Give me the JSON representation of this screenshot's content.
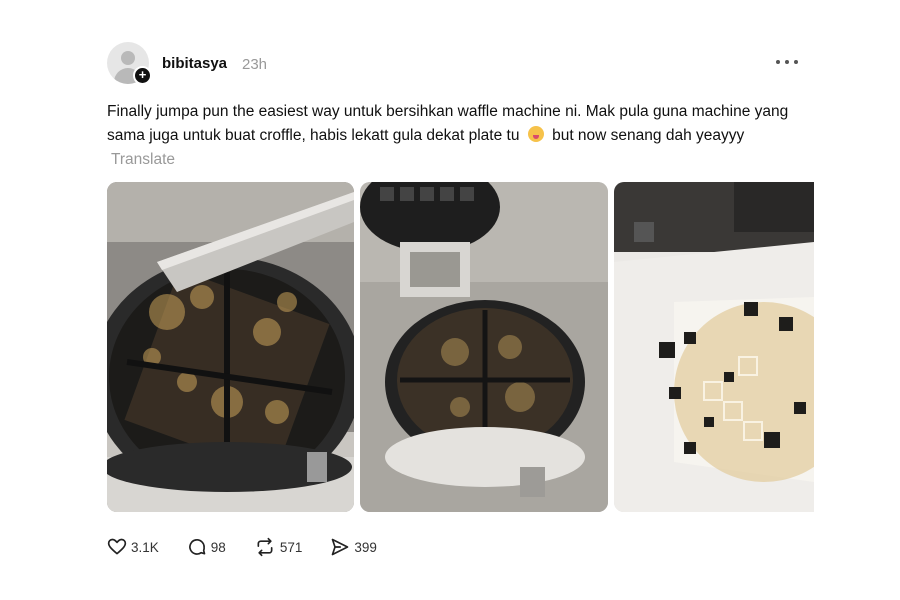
{
  "post": {
    "username": "bibitasya",
    "time": "23h",
    "text_before_emoji": "Finally jumpa pun the easiest way untuk bersihkan waffle machine ni. Mak pula guna machine yang sama juga untuk buat croffle, habis lekatt gula dekat plate tu",
    "text_after_emoji": "but now senang dah yeayyy",
    "translate_label": "Translate",
    "media": [
      {
        "description": "waffle maker plate with tongs scraping caramelized sugar"
      },
      {
        "description": "open waffle maker with dirty lower plate"
      },
      {
        "description": "peeled caramelized sugar waffle on paper towel"
      }
    ]
  },
  "actions": {
    "likes": "3.1K",
    "replies": "98",
    "reposts": "571",
    "shares": "399"
  },
  "icons": {
    "avatar": "default-avatar-icon",
    "follow": "plus-icon",
    "more": "more-horizontal-icon",
    "like": "heart-icon",
    "reply": "comment-icon",
    "repost": "repost-icon",
    "share": "send-icon"
  }
}
